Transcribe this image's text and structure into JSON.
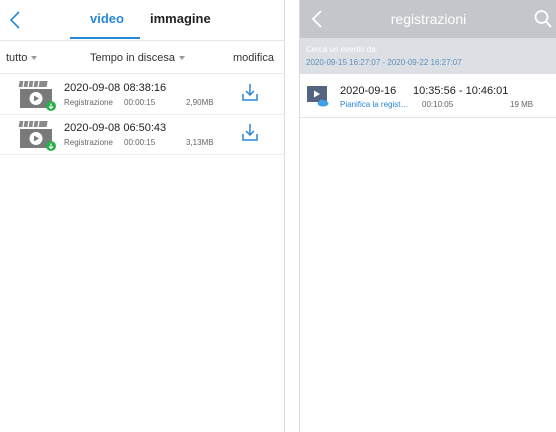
{
  "left_panel": {
    "tabs": [
      {
        "label": "video",
        "active": true
      },
      {
        "label": "immagine",
        "active": false
      }
    ],
    "filter": {
      "all_label": "tutto",
      "sort_label": "Tempo in discesa",
      "edit_label": "modifica"
    },
    "items": [
      {
        "datetime": "2020-09-08 08:38:16",
        "name": "Registrazione",
        "duration": "00:00:15",
        "size": "2,90MB"
      },
      {
        "datetime": "2020-09-08 06:50:43",
        "name": "Registrazione",
        "duration": "00:00:15",
        "size": "3,13MB"
      }
    ],
    "accent_color": "#2a87d8"
  },
  "right_panel": {
    "title": "registrazioni",
    "search_range": {
      "label": "Cerca un evento da:",
      "value": "2020-09-15 16:27:07 - 2020-09-22 16:27:07"
    },
    "items": [
      {
        "date": "2020-09-16",
        "time_range": "10:35:56 - 10:46:01",
        "description": "Pianifica la registrazione",
        "duration": "00:10:05",
        "size": "19 MB"
      }
    ],
    "header_color": "#c3c7cc"
  },
  "icons": [
    "back-arrow-icon",
    "caret-down-icon",
    "video-thumbnail-icon",
    "download-icon",
    "search-icon",
    "cloud-icon"
  ]
}
